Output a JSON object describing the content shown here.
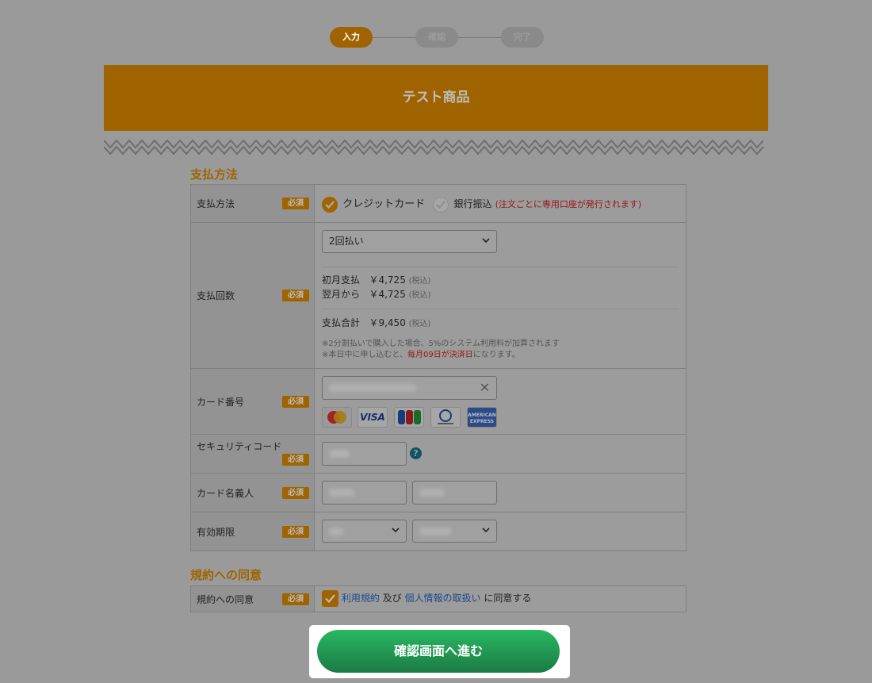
{
  "stepper": {
    "steps": [
      "入力",
      "確認",
      "完了"
    ]
  },
  "header": {
    "title": "テスト商品"
  },
  "payment_section": {
    "title": "支払方法",
    "required_badge": "必須",
    "method": {
      "label": "支払方法",
      "options": [
        "クレジットカード",
        "銀行振込"
      ],
      "bank_note": "(注文ごとに専用口座が発行されます)"
    },
    "installments": {
      "label": "支払回数",
      "selected": "2回払い",
      "first_month_label": "初月支払",
      "first_month_amount": "￥4,725",
      "next_month_label": "翌月から",
      "next_month_amount": "￥4,725",
      "total_label": "支払合計",
      "total_amount": "￥9,450",
      "tax_note": "(税込)",
      "note1": "※2分割払いで購入した場合、5%のシステム利用料が加算されます",
      "note2_prefix": "※本日中に申し込むと、",
      "note2_highlight": "毎月09日が決済日",
      "note2_suffix": "になります。"
    },
    "card_number": {
      "label": "カード番号",
      "brands": [
        "MasterCard",
        "VISA",
        "JCB",
        "Diners Club",
        "AMERICAN EXPRESS"
      ]
    },
    "security_code": {
      "label": "セキュリティコード"
    },
    "card_holder": {
      "label": "カード名義人"
    },
    "expiry": {
      "label": "有効期限"
    }
  },
  "terms_section": {
    "title": "規約への同意",
    "label": "規約への同意",
    "terms_link": "利用規約",
    "and": "及び",
    "privacy_link": "個人情報の取扱い",
    "agree": "に同意する"
  },
  "submit": {
    "label": "確認画面へ進む"
  },
  "colors": {
    "accent": "#9f6400",
    "button": "#22a055"
  }
}
